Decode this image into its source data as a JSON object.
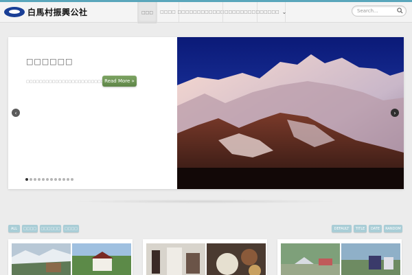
{
  "header": {
    "logo_text": "白馬村振興公社",
    "nav": [
      {
        "label": "□□□",
        "active": true
      },
      {
        "label": "□□□□"
      },
      {
        "label": "□□□□□□□□□□□□"
      },
      {
        "label": "□□□□□□□□"
      },
      {
        "label": "□□□□□□"
      }
    ],
    "search_placeholder": "Search..."
  },
  "slider": {
    "title": "□□□□□□",
    "text": "□□□□□□□□□□□□□□□□□□□□□□□□□",
    "read_more": "Read More »",
    "dot_count": 12,
    "active_dot": 0
  },
  "filters": [
    {
      "label": "ALL"
    },
    {
      "label": "□□□□"
    },
    {
      "label": "□□□□□□"
    },
    {
      "label": "□□□□"
    }
  ],
  "sorts": [
    {
      "label": "DEFAULT"
    },
    {
      "label": "TITLE"
    },
    {
      "label": "DATE"
    },
    {
      "label": "RANDOM"
    }
  ],
  "colors": {
    "accent": "#5aa6bb",
    "filter_button": "#a9cdd6",
    "read_more": "#6f9656"
  }
}
